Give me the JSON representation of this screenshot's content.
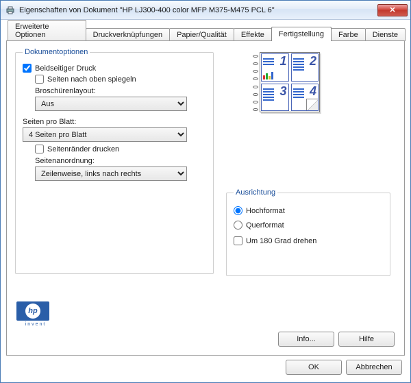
{
  "window": {
    "title": "Eigenschaften von Dokument \"HP LJ300-400 color MFP M375-M475 PCL 6\""
  },
  "tabs": {
    "items": [
      "Erweiterte Optionen",
      "Druckverknüpfungen",
      "Papier/Qualität",
      "Effekte",
      "Fertigstellung",
      "Farbe",
      "Dienste"
    ],
    "active_index": 4
  },
  "doc_options": {
    "legend": "Dokumentoptionen",
    "duplex_label": "Beidseitiger Druck",
    "duplex_checked": true,
    "flip_up_label": "Seiten nach oben spiegeln",
    "flip_up_checked": false,
    "booklet_label": "Broschürenlayout:",
    "booklet_value": "Aus",
    "pages_per_sheet_label": "Seiten pro Blatt:",
    "pages_per_sheet_value": "4 Seiten pro Blatt",
    "print_borders_label": "Seitenränder drucken",
    "print_borders_checked": false,
    "page_order_label": "Seitenanordnung:",
    "page_order_value": "Zeilenweise, links nach rechts"
  },
  "orientation": {
    "legend": "Ausrichtung",
    "portrait_label": "Hochformat",
    "landscape_label": "Querformat",
    "selected": "portrait",
    "rotate180_label": "Um 180 Grad drehen",
    "rotate180_checked": false
  },
  "preview": {
    "numbers": [
      "1",
      "2",
      "3",
      "4"
    ]
  },
  "footer": {
    "logo_text": "hp",
    "logo_sub": "invent",
    "info_label": "Info...",
    "help_label": "Hilfe"
  },
  "dialog_buttons": {
    "ok": "OK",
    "cancel": "Abbrechen"
  }
}
